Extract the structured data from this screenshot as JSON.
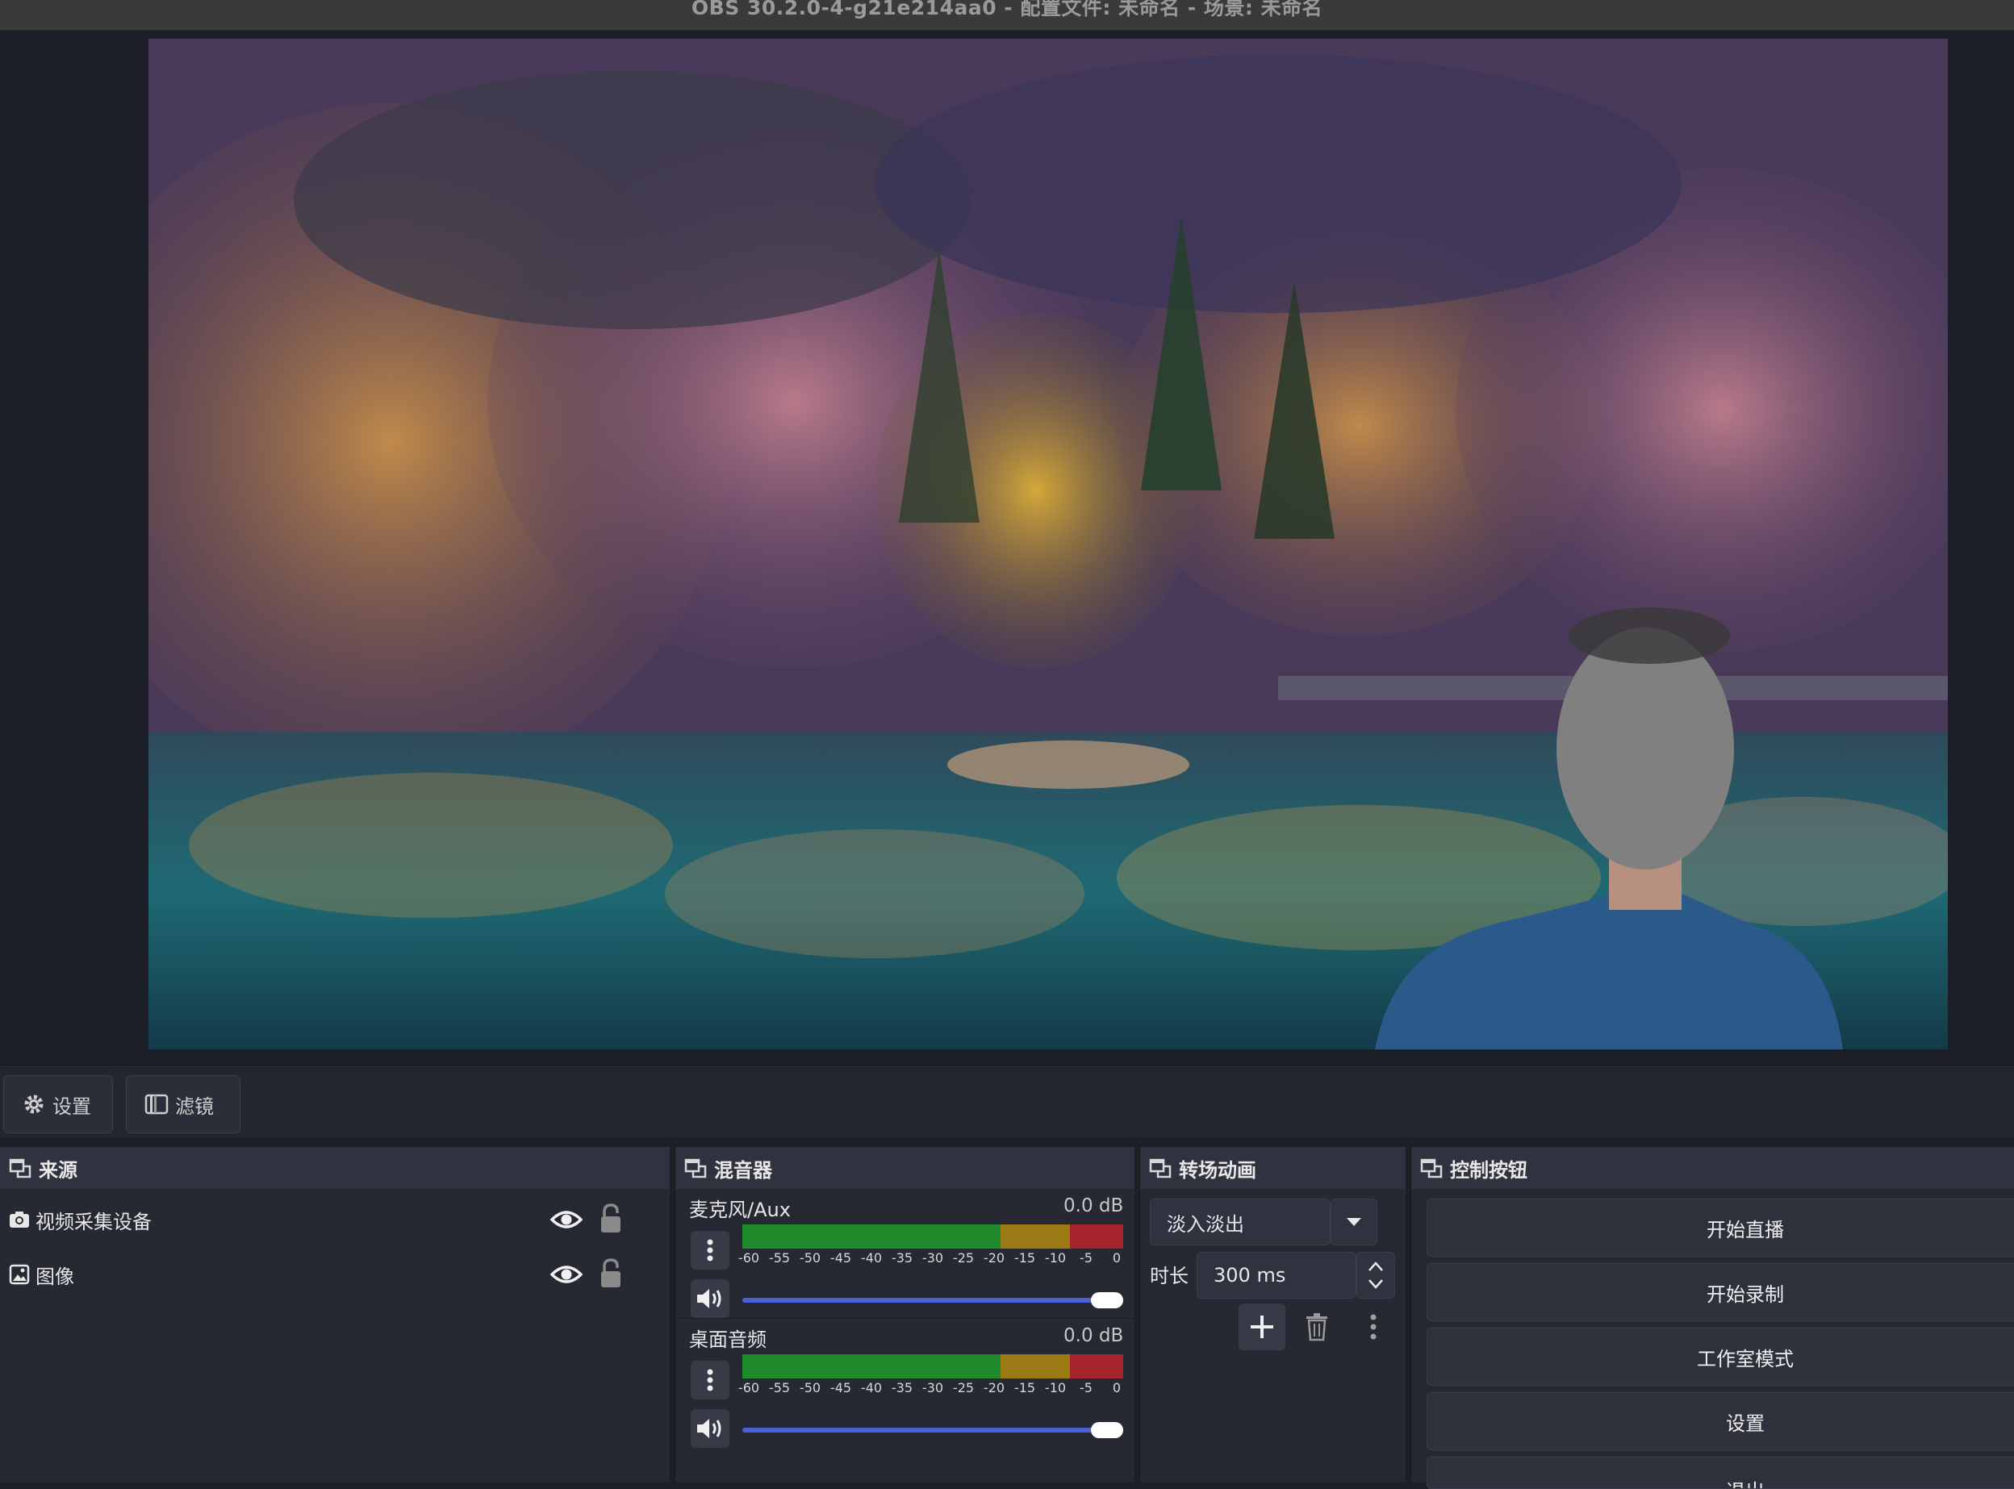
{
  "window": {
    "title": "OBS 30.2.0-4-g21e214aa0 - 配置文件: 未命名 - 场景: 未命名"
  },
  "toolbar": {
    "settings_label": "设置",
    "filters_label": "滤镜"
  },
  "sources": {
    "title": "来源",
    "items": [
      {
        "name": "视频采集设备",
        "icon": "camera-icon"
      },
      {
        "name": "图像",
        "icon": "image-icon"
      }
    ]
  },
  "mixer": {
    "title": "混音器",
    "ticks": [
      "-60",
      "-55",
      "-50",
      "-45",
      "-40",
      "-35",
      "-30",
      "-25",
      "-20",
      "-15",
      "-10",
      "-5",
      "0"
    ],
    "channels": [
      {
        "name": "麦克风/Aux",
        "db": "0.0 dB",
        "volume": 1.0
      },
      {
        "name": "桌面音频",
        "db": "0.0 dB",
        "volume": 1.0
      }
    ]
  },
  "transitions": {
    "title": "转场动画",
    "selected": "淡入淡出",
    "duration_label": "时长",
    "duration_value": "300 ms"
  },
  "controls": {
    "title": "控制按钮",
    "buttons": [
      "开始直播",
      "开始录制",
      "工作室模式",
      "设置",
      "退出"
    ]
  },
  "colors": {
    "accent": "#4a62d6",
    "meter_green": "#1f8a2c",
    "meter_yellow": "#9a7a14",
    "meter_red": "#a5242c"
  }
}
